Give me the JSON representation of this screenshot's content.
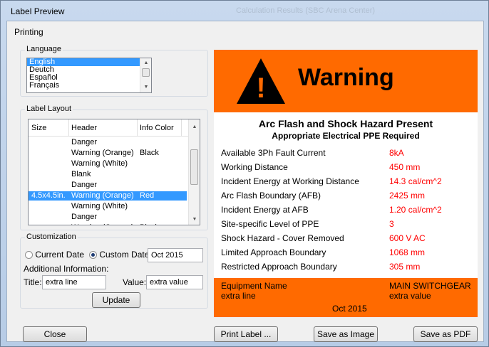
{
  "window": {
    "title": "Label Preview",
    "background_title": "Calculation Results (SBC Arena Center)"
  },
  "tab": {
    "label": "Printing"
  },
  "language": {
    "group_label": "Language",
    "items": [
      "English",
      "Deutch",
      "Español",
      "Français"
    ],
    "selected": "English"
  },
  "label_layout": {
    "group_label": "Label Layout",
    "columns": [
      "Size",
      "Header",
      "Info Color"
    ],
    "rows": [
      {
        "size": "",
        "header": "Danger",
        "color": ""
      },
      {
        "size": "",
        "header": "Warning (Orange)",
        "color": "Black"
      },
      {
        "size": "",
        "header": "Warning (White)",
        "color": ""
      },
      {
        "size": "",
        "header": "Blank",
        "color": ""
      },
      {
        "size": "",
        "header": "Danger",
        "color": ""
      },
      {
        "size": "4.5x4.5in.",
        "header": "Warning (Orange)",
        "color": "Red"
      },
      {
        "size": "",
        "header": "Warning (White)",
        "color": ""
      },
      {
        "size": "",
        "header": "Danger",
        "color": ""
      },
      {
        "size": "",
        "header": "Warning (Orange)",
        "color": "Black"
      }
    ],
    "selected_index": 5
  },
  "customization": {
    "group_label": "Customization",
    "current_date_label": "Current Date",
    "custom_date_label": "Custom Date",
    "custom_date_value": "Oct 2015",
    "date_mode": "custom",
    "additional_info_label": "Additional Information:",
    "title_label": "Title:",
    "title_value": "extra line",
    "value_label": "Value:",
    "value_value": "extra value",
    "update_label": "Update"
  },
  "preview": {
    "header": "Warning",
    "title": "Arc Flash and Shock Hazard Present",
    "subtitle": "Appropriate Electrical PPE Required",
    "rows": [
      {
        "label": "Available 3Ph Fault Current",
        "value": "8kA"
      },
      {
        "label": "Working Distance",
        "value": "450 mm"
      },
      {
        "label": "Incident Energy at Working Distance",
        "value": "14.3 cal/cm^2"
      },
      {
        "label": "Arc Flash Boundary (AFB)",
        "value": "2425 mm"
      },
      {
        "label": "Incident Energy at AFB",
        "value": "1.20 cal/cm^2"
      },
      {
        "label": "Site-specific Level of PPE",
        "value": "3"
      },
      {
        "label": "Shock Hazard - Cover Removed",
        "value": "600 V AC"
      },
      {
        "label": "Limited Approach Boundary",
        "value": "1068 mm"
      },
      {
        "label": "Restricted Approach Boundary",
        "value": "305 mm"
      }
    ],
    "footer": {
      "equipment_label": "Equipment Name",
      "equipment_value": "MAIN SWITCHGEAR",
      "extra_title": "extra line",
      "extra_value": "extra value",
      "date": "Oct 2015"
    },
    "colors": {
      "band": "#ff6a00",
      "value": "#ff0000"
    }
  },
  "buttons": {
    "close": "Close",
    "print": "Print Label ...",
    "save_image": "Save as Image",
    "save_pdf": "Save as PDF"
  }
}
